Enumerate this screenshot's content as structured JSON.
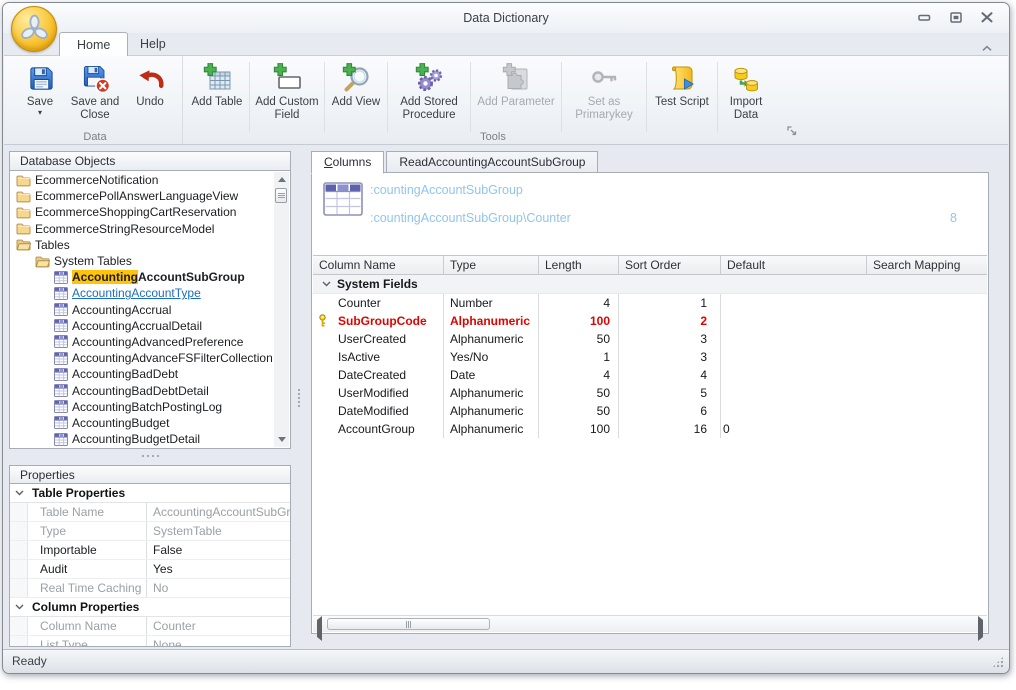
{
  "window": {
    "title": "Data Dictionary",
    "status_text": "Ready"
  },
  "colors": {
    "modified_row": "#dd0400",
    "link_item": "#1b6ec2",
    "search_highlight": "#ffc30b",
    "path_link": "#8fc6ee"
  },
  "ribbon_tabs": [
    {
      "label": "Home",
      "active": true
    },
    {
      "label": "Help",
      "active": false
    }
  ],
  "ribbon": {
    "groups": [
      {
        "label": "Data",
        "buttons": [
          {
            "label": "Save",
            "dropdown": true
          },
          {
            "label": "Save and Close"
          },
          {
            "label": "Undo"
          }
        ]
      },
      {
        "label": "Tools",
        "buttons": [
          {
            "label": "Add Table"
          },
          {
            "label": "Add Custom Field"
          },
          {
            "label": "Add View"
          },
          {
            "label": "Add Stored Procedure"
          },
          {
            "label": "Add Parameter",
            "disabled": true
          },
          {
            "label": "Set as Primarykey",
            "disabled": true
          },
          {
            "label": "Test Script"
          },
          {
            "label": "Import Data"
          }
        ]
      }
    ]
  },
  "explorer": {
    "title": "Database Objects",
    "items": [
      {
        "label": "EcommerceNotification",
        "icon": "folder",
        "indent": 0
      },
      {
        "label": "EcommercePollAnswerLanguageView",
        "icon": "folder",
        "indent": 0
      },
      {
        "label": "EcommerceShoppingCartReservation",
        "icon": "folder",
        "indent": 0
      },
      {
        "label": "EcommerceStringResourceModel",
        "icon": "folder",
        "indent": 0
      },
      {
        "label": "Tables",
        "icon": "folder-open",
        "indent": 0
      },
      {
        "label": "System Tables",
        "icon": "folder-open",
        "indent": 1
      },
      {
        "label": "AccountingAccountSubGroup",
        "icon": "table",
        "indent": 2,
        "match": "Accounting",
        "rest": "AccountSubGroup",
        "selected": true
      },
      {
        "label": "AccountingAccountType",
        "icon": "table",
        "indent": 2,
        "link": true
      },
      {
        "label": "AccountingAccrual",
        "icon": "table",
        "indent": 2
      },
      {
        "label": "AccountingAccrualDetail",
        "icon": "table",
        "indent": 2
      },
      {
        "label": "AccountingAdvancedPreference",
        "icon": "table",
        "indent": 2
      },
      {
        "label": "AccountingAdvanceFSFilterCollection",
        "icon": "table",
        "indent": 2
      },
      {
        "label": "AccountingBadDebt",
        "icon": "table",
        "indent": 2
      },
      {
        "label": "AccountingBadDebtDetail",
        "icon": "table",
        "indent": 2
      },
      {
        "label": "AccountingBatchPostingLog",
        "icon": "table",
        "indent": 2
      },
      {
        "label": "AccountingBudget",
        "icon": "table",
        "indent": 2
      },
      {
        "label": "AccountingBudgetDetail",
        "icon": "table",
        "indent": 2
      },
      {
        "label": "",
        "icon": "table",
        "indent": 2
      }
    ]
  },
  "properties": {
    "title": "Properties",
    "groups": [
      {
        "label": "Table Properties",
        "rows": [
          {
            "name": "Table Name",
            "value": "AccountingAccountSubGr...",
            "readonly": true
          },
          {
            "name": "Type",
            "value": "SystemTable",
            "readonly": true
          },
          {
            "name": "Importable",
            "value": "False",
            "readonly": false
          },
          {
            "name": "Audit",
            "value": "Yes",
            "readonly": false
          },
          {
            "name": "Real Time Caching",
            "value": "No",
            "readonly": true
          }
        ]
      },
      {
        "label": "Column Properties",
        "rows": [
          {
            "name": "Column Name",
            "value": "Counter",
            "readonly": true
          },
          {
            "name": "List Type",
            "value": "None",
            "readonly": true
          }
        ]
      }
    ]
  },
  "main": {
    "tabs": [
      {
        "label": "Columns",
        "active": true
      },
      {
        "label": "ReadAccountingAccountSubGroup",
        "active": false
      }
    ],
    "header": {
      "table_path": ":countingAccountSubGroup",
      "column_path": ":countingAccountSubGroup\\Counter",
      "count": "8"
    },
    "grid": {
      "columns": [
        "Column Name",
        "Type",
        "Length",
        "Sort Order",
        "Default",
        "Search Mapping"
      ],
      "group_label": "System Fields",
      "rows": [
        {
          "name": "Counter",
          "type": "Number",
          "length": "4",
          "sort_order": "1",
          "default": "",
          "search_mapping": "",
          "primary_key": false,
          "modified": false
        },
        {
          "name": "SubGroupCode",
          "type": "Alphanumeric",
          "length": "100",
          "sort_order": "2",
          "default": "",
          "search_mapping": "",
          "primary_key": true,
          "modified": true
        },
        {
          "name": "UserCreated",
          "type": "Alphanumeric",
          "length": "50",
          "sort_order": "3",
          "default": "",
          "search_mapping": "",
          "primary_key": false,
          "modified": false
        },
        {
          "name": "IsActive",
          "type": "Yes/No",
          "length": "1",
          "sort_order": "3",
          "default": "",
          "search_mapping": "",
          "primary_key": false,
          "modified": false
        },
        {
          "name": "DateCreated",
          "type": "Date",
          "length": "4",
          "sort_order": "4",
          "default": "",
          "search_mapping": "",
          "primary_key": false,
          "modified": false
        },
        {
          "name": "UserModified",
          "type": "Alphanumeric",
          "length": "50",
          "sort_order": "5",
          "default": "",
          "search_mapping": "",
          "primary_key": false,
          "modified": false
        },
        {
          "name": "DateModified",
          "type": "Alphanumeric",
          "length": "50",
          "sort_order": "6",
          "default": "",
          "search_mapping": "",
          "primary_key": false,
          "modified": false
        },
        {
          "name": "AccountGroup",
          "type": "Alphanumeric",
          "length": "100",
          "sort_order": "16",
          "default": "0",
          "search_mapping": "",
          "primary_key": false,
          "modified": false
        }
      ]
    }
  }
}
